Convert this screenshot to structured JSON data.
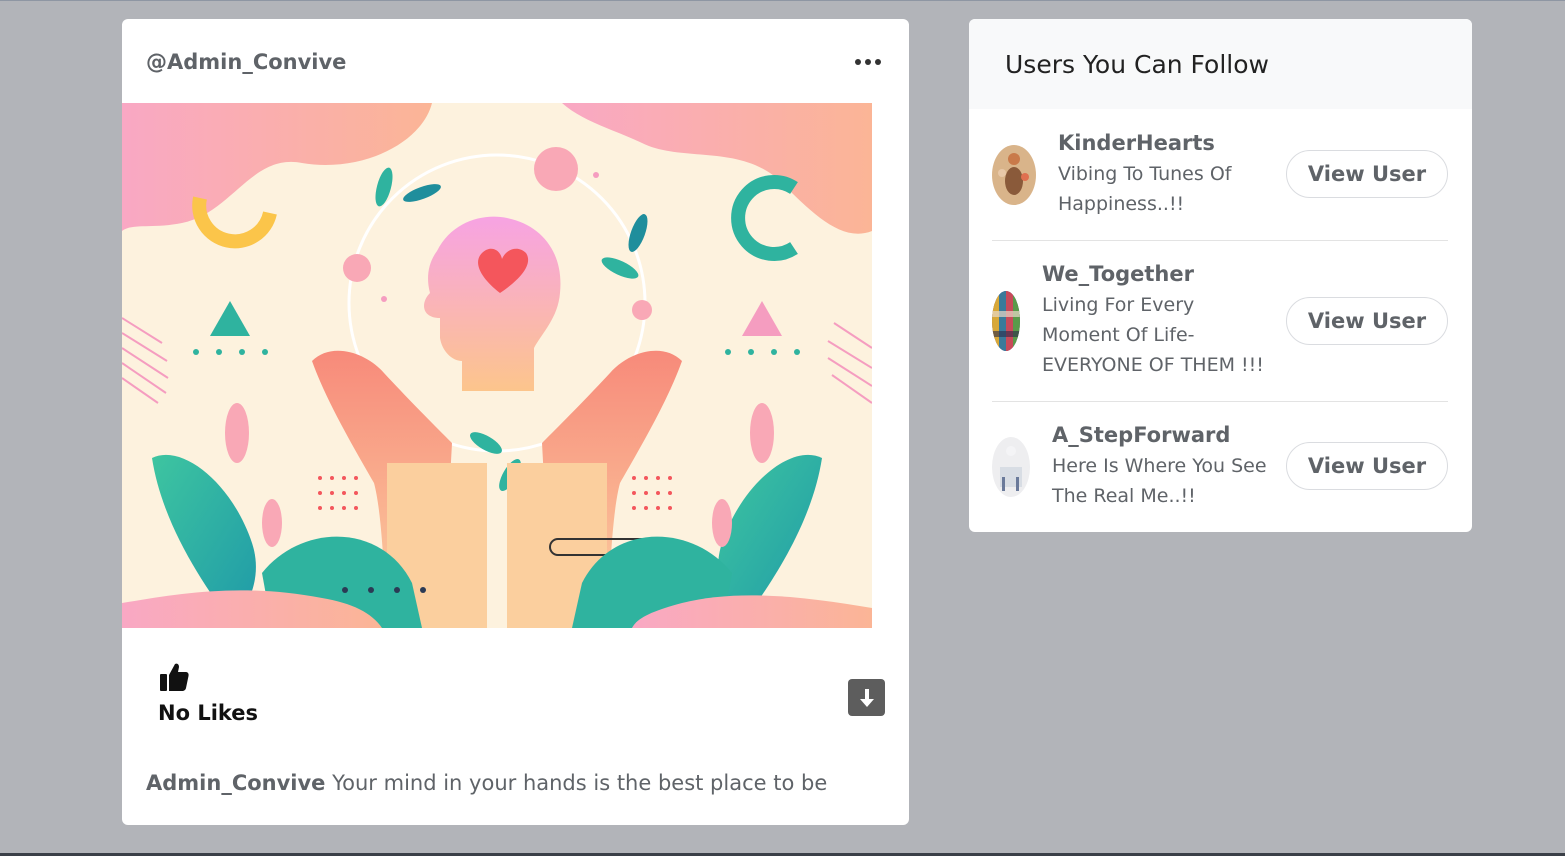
{
  "post": {
    "username": "@Admin_Convive",
    "likes_label": "No Likes",
    "caption_author": "Admin_Convive",
    "caption_text": " Your mind in your hands is the best place to be"
  },
  "follow_panel": {
    "title": "Users You Can Follow",
    "users": [
      {
        "name": "KinderHearts",
        "bio_lines": [
          "Vibing To Tunes Of",
          "Happiness..!!"
        ],
        "button": "View User"
      },
      {
        "name": "We_Together",
        "bio_lines": [
          "Living For Every",
          "Moment Of Life-",
          "EVERYONE OF THEM !!!"
        ],
        "button": "View User"
      },
      {
        "name": "A_StepForward",
        "bio_lines": [
          "Here Is Where You See",
          "The Real Me..!!"
        ],
        "button": "View User"
      }
    ]
  },
  "colors": {
    "page_background": "#b2b4b9",
    "card_background": "#ffffff",
    "text_muted": "#5f6368",
    "download_button": "#5d5d5d"
  },
  "icons": {
    "more": "more-horizontal-icon",
    "like": "thumbs-up-icon",
    "download": "download-icon"
  }
}
